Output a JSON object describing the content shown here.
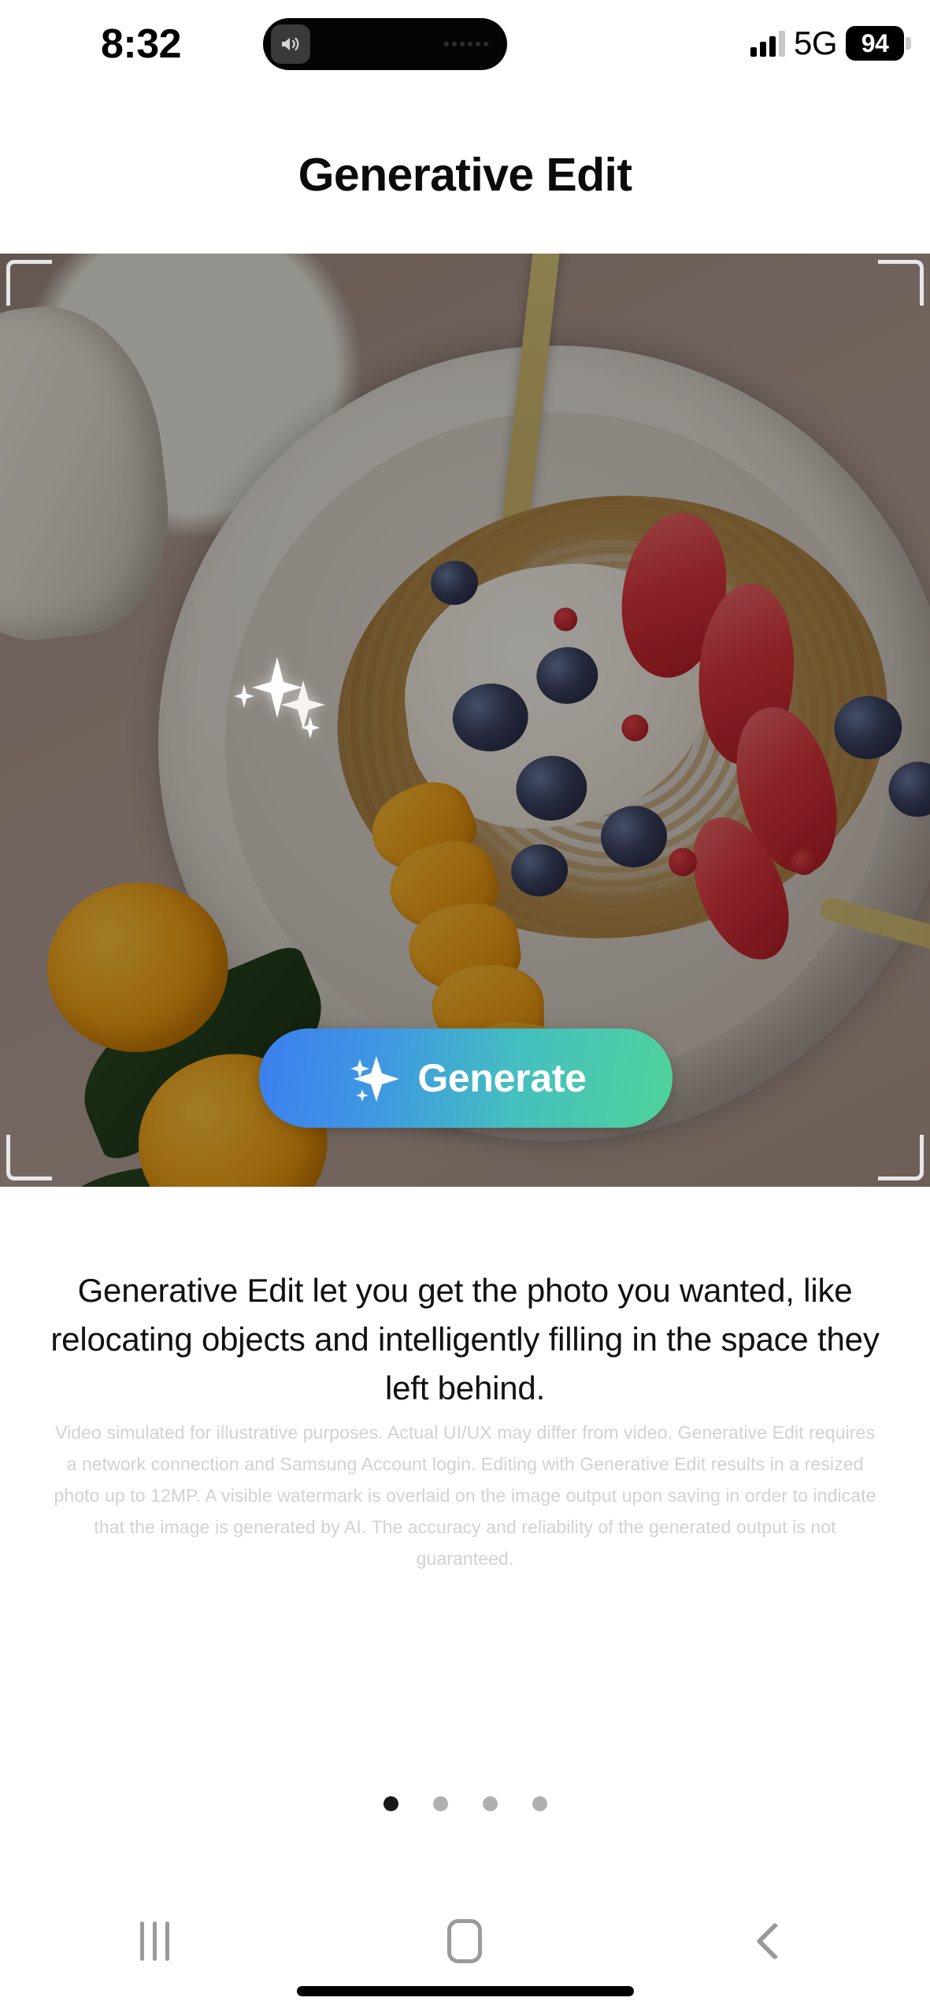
{
  "status_bar": {
    "time": "8:32",
    "speaker_icon": "speaker-volume-icon",
    "network": "5G",
    "signal_bars_filled": 3,
    "signal_bars_total": 4,
    "battery_level": "94"
  },
  "header": {
    "title": "Generative Edit"
  },
  "canvas": {
    "name": "generative-edit-photo-canvas",
    "background": "transparency-checkerboard",
    "photo_subject": "yogurt bowl with granola, strawberries, blueberries and orange segments",
    "rotation_hint": "photo rotated counter-clockwise inside crop frame",
    "crop_handles": [
      "top-left",
      "top-right",
      "bottom-left",
      "bottom-right"
    ],
    "sparkles": [
      "large-sparkle",
      "small-sparkle",
      "tiny-sparkle",
      "mini-sparkle"
    ]
  },
  "generate_button": {
    "label": "Generate",
    "icon": "sparkle-icon",
    "gradient_start": "#3b7ff0",
    "gradient_end": "#4fd39a"
  },
  "description": "Generative Edit let you get the photo you wanted, like relocating objects and intelligently filling in the space they left behind.",
  "fineprint": "Video simulated for illustrative purposes. Actual UI/UX may differ from video. Generative Edit requires a network connection and Samsung Account login. Editing with Generative Edit results in a resized photo up to 12MP. A visible watermark is overlaid on the image output upon saving in order to indicate that the image is generated by AI. The accuracy and reliability of the generated output is not guaranteed.",
  "pagination": {
    "total": 4,
    "active_index": 0
  },
  "navigation_bar": {
    "recents_label": "Recents",
    "home_label": "Home",
    "back_label": "Back"
  }
}
